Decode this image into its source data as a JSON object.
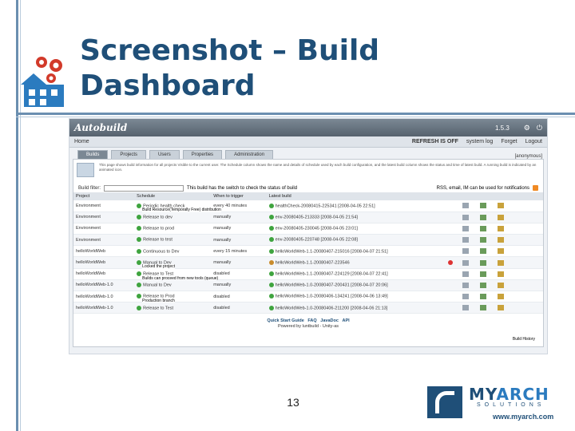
{
  "slide": {
    "title_line1": "Screenshot – Build",
    "title_line2": "Dashboard",
    "page_number": "13"
  },
  "app": {
    "title": "Autobuild",
    "version": "1.5.3",
    "header_links": [
      "Preferences",
      "Logout"
    ],
    "home": "Home",
    "refresh": "REFRESH IS OFF",
    "system_log": "system log",
    "forget": "Forget",
    "login": "Logout",
    "account": "[anonymous]",
    "tabs": [
      "Builds",
      "Projects",
      "Users",
      "Properties",
      "Administration"
    ],
    "info_text": "This page shows build information for all projects Visible to the current user. The Schedule column shows the name and details of schedule used by each build configuration, and the latest build column shows the status and time of latest build. A running build is indicated by an animated icon.",
    "filter_label": "Build filter:",
    "annotation_filter": "This build has the switch to check the status of build",
    "annotation_rss": "RSS, email, IM can be used for notifications",
    "annotation_row1": "Build Resource(Temporally Free) distribution",
    "annotation_row6": "Locked the project",
    "annotation_row7": "Builds can proceed from new tools (queue)",
    "annotation_row9": "Production branch",
    "annotation_history": "Build History",
    "columns": [
      "Project",
      "Schedule",
      "When to trigger",
      "Latest build"
    ],
    "rows": [
      {
        "project": "Environment",
        "schedule": "Periodic health check",
        "trigger": "every 40 minutes",
        "latest": "healthCheck-20080415-225341 [2008-04-05 22:51]",
        "status": "ok"
      },
      {
        "project": "Environment",
        "schedule": "Release to dev",
        "trigger": "manually",
        "latest": "env-20080405-213333 [2008-04-05 21:54]",
        "status": "ok"
      },
      {
        "project": "Environment",
        "schedule": "Release to prod",
        "trigger": "manually",
        "latest": "env-20080405-230045 [2008-04-05 23:01]",
        "status": "ok"
      },
      {
        "project": "Environment",
        "schedule": "Release to test",
        "trigger": "manually",
        "latest": "env-20080405-220748 [2008-04-05 22:08]",
        "status": "ok"
      },
      {
        "project": "helloWorldWeb",
        "schedule": "Continuous to Dev",
        "trigger": "every 15 minutes",
        "latest": "helloWorldWeb-1.1-20080407-215016 [2008-04-07 21:51]",
        "status": "ok"
      },
      {
        "project": "helloWorldWeb",
        "schedule": "Manual to Dev",
        "trigger": "manually",
        "latest": "helloWorldWeb-1.1-20080407-223546",
        "status": "running"
      },
      {
        "project": "helloWorldWeb",
        "schedule": "Release to Test",
        "trigger": "disabled",
        "latest": "helloWorldWeb-1.1-20080407-224129 [2008-04-07 22:41]",
        "status": "ok"
      },
      {
        "project": "helloWorldWeb-1.0",
        "schedule": "Manual to Dev",
        "trigger": "manually",
        "latest": "helloWorldWeb-1.0-20080407-200431 [2008-04-07 20:06]",
        "status": "ok"
      },
      {
        "project": "helloWorldWeb-1.0",
        "schedule": "Release to Prod",
        "trigger": "disabled",
        "latest": "helloWorldWeb-1.0-20080406-134241 [2008-04-06 13:49]",
        "status": "ok"
      },
      {
        "project": "helloWorldWeb-1.0",
        "schedule": "Release to Test",
        "trigger": "disabled",
        "latest": "helloWorldWeb-1.0-20080406-211200 [2008-04-06 21:13]",
        "status": "ok"
      }
    ],
    "footer_links": [
      "Quick Start Guide",
      "FAQ",
      "JavaDoc",
      "API"
    ],
    "footer_powered": "Powered by luntbuild - Unity-as"
  },
  "brand": {
    "my": "MY",
    "arch": "ARCH",
    "sub": "SOLUTIONS",
    "url": "www.myarch.com",
    "colors": {
      "primary": "#1f4f78",
      "accent": "#2b7bbf"
    }
  }
}
